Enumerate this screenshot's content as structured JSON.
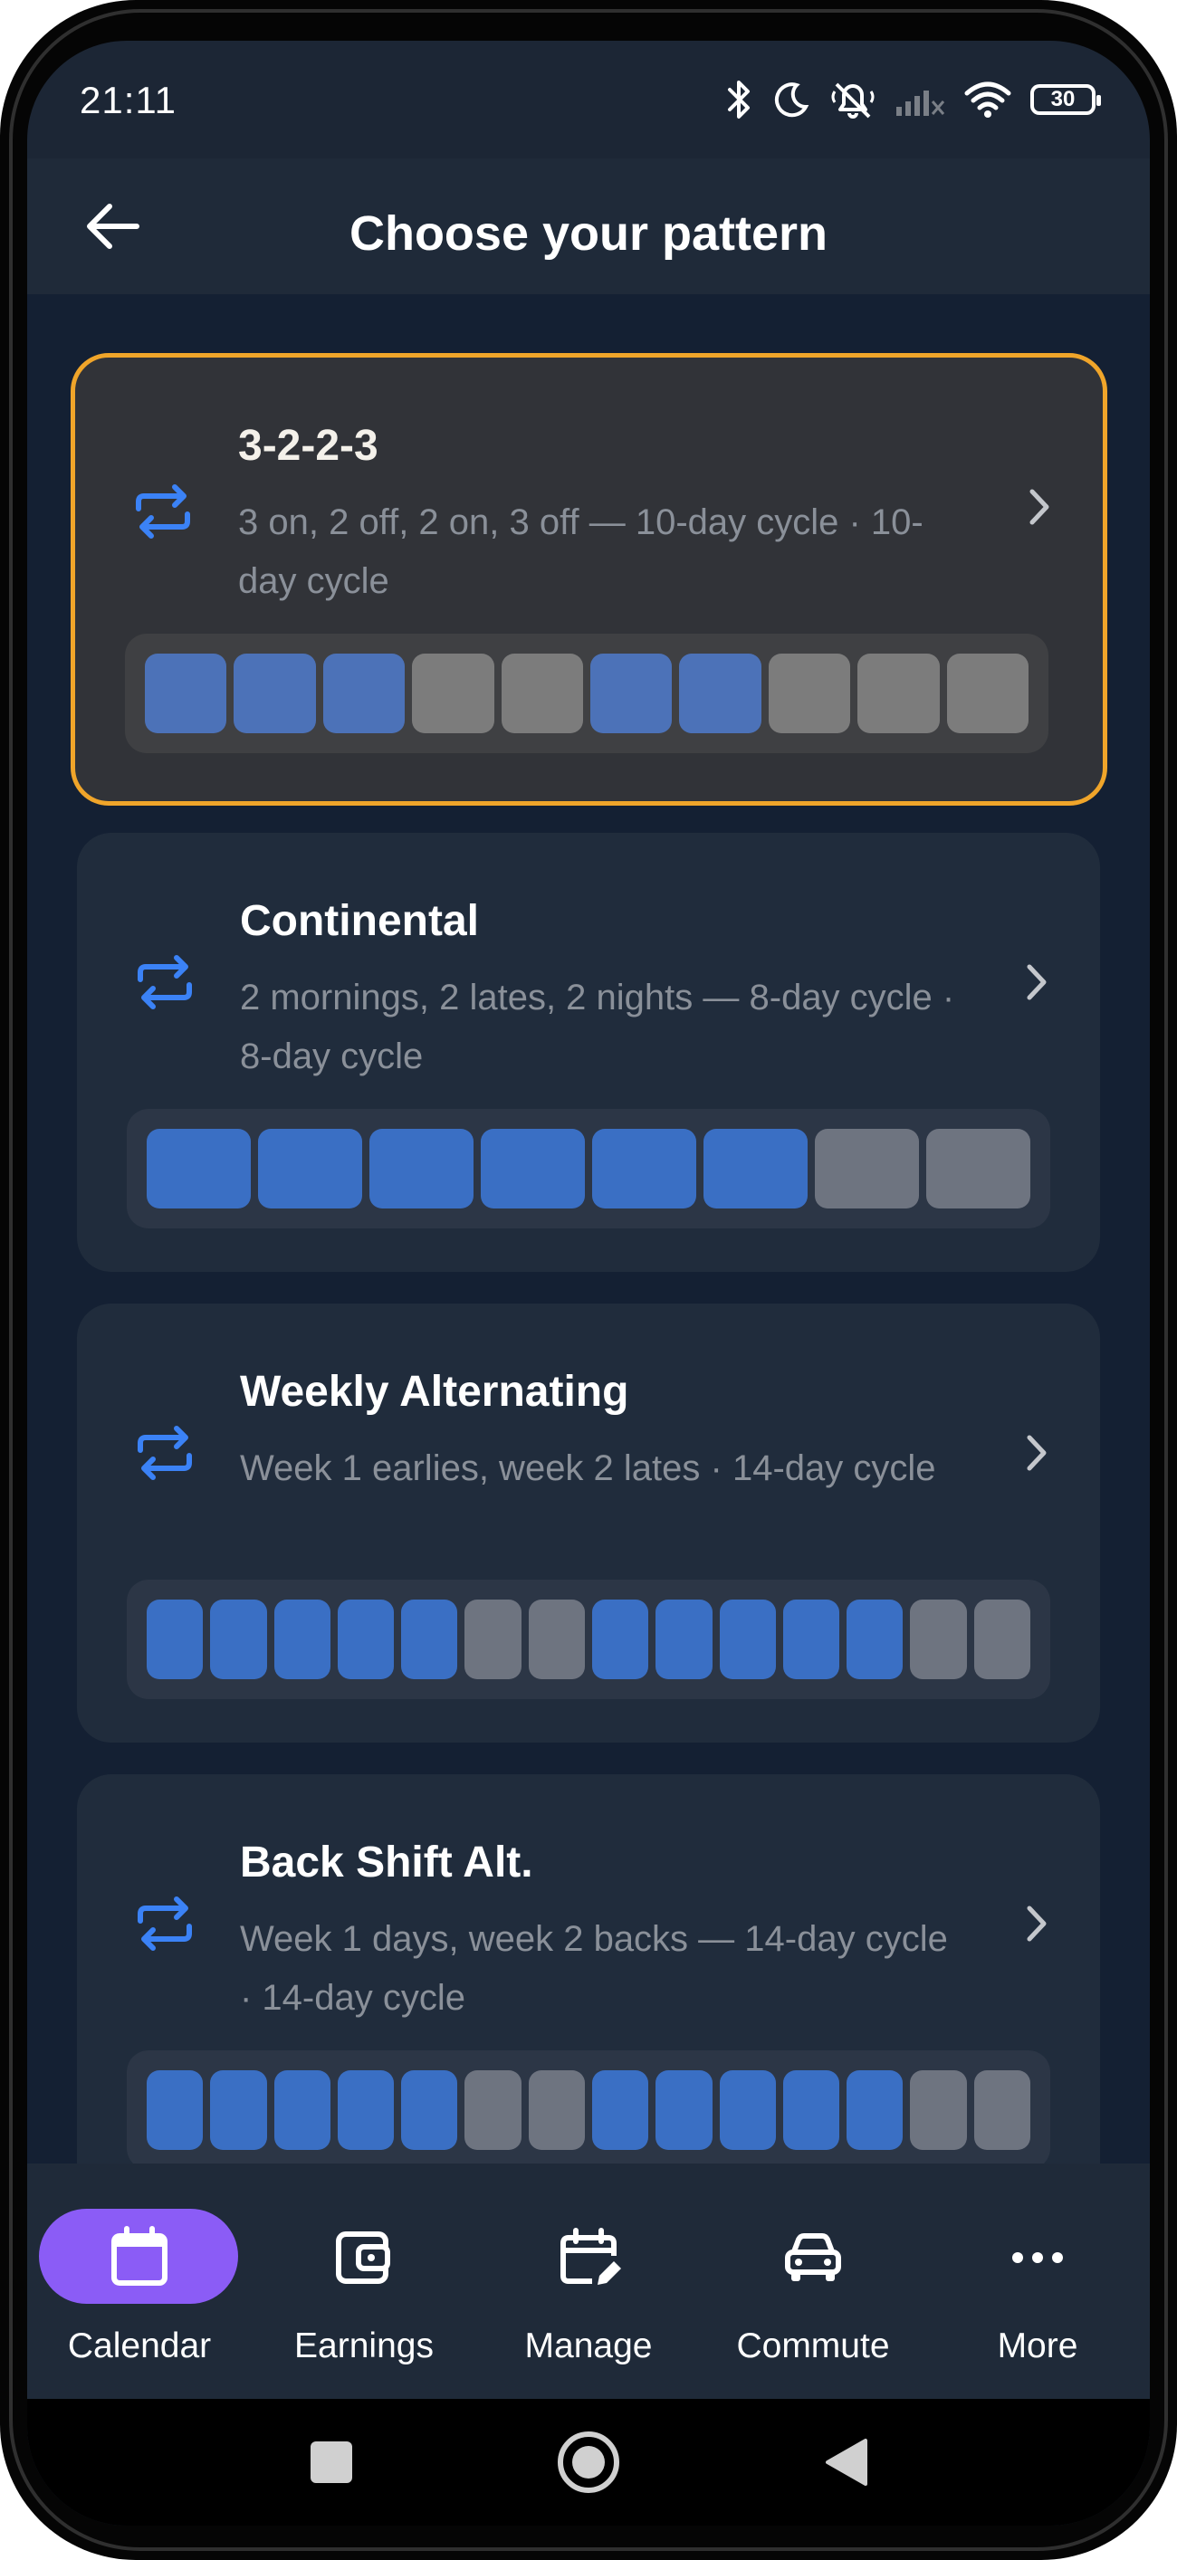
{
  "status_bar": {
    "time": "21:11",
    "battery": "30"
  },
  "header": {
    "title": "Choose your pattern"
  },
  "colors": {
    "on_selected": "#4c72b8",
    "off_selected": "#7c7c7c",
    "on": "#3a6fc4",
    "off": "#6e7480",
    "accent_border": "#f0a52a",
    "nav_active": "#8b5cf6",
    "icon_blue": "#3b82f6"
  },
  "patterns": [
    {
      "title": "3-2-2-3",
      "subtitle": "3 on, 2 off, 2 on, 3 off — 10-day cycle · 10-day cycle",
      "selected": true,
      "days": [
        1,
        1,
        1,
        0,
        0,
        1,
        1,
        0,
        0,
        0
      ]
    },
    {
      "title": "Continental",
      "subtitle": "2 mornings, 2 lates, 2 nights — 8-day cycle · 8-day cycle",
      "selected": false,
      "days": [
        1,
        1,
        1,
        1,
        1,
        1,
        0,
        0
      ]
    },
    {
      "title": "Weekly Alternating",
      "subtitle": "Week 1 earlies, week 2 lates · 14-day cycle",
      "selected": false,
      "days": [
        1,
        1,
        1,
        1,
        1,
        0,
        0,
        1,
        1,
        1,
        1,
        1,
        0,
        0
      ]
    },
    {
      "title": "Back Shift Alt.",
      "subtitle": "Week 1 days, week 2 backs — 14-day cycle · 14-day cycle",
      "selected": false,
      "days": [
        1,
        1,
        1,
        1,
        1,
        0,
        0,
        1,
        1,
        1,
        1,
        1,
        0,
        0
      ]
    }
  ],
  "nav": {
    "items": [
      {
        "label": "Calendar",
        "icon": "calendar-icon",
        "active": true
      },
      {
        "label": "Earnings",
        "icon": "wallet-icon",
        "active": false
      },
      {
        "label": "Manage",
        "icon": "calendar-edit-icon",
        "active": false
      },
      {
        "label": "Commute",
        "icon": "car-icon",
        "active": false
      },
      {
        "label": "More",
        "icon": "more-icon",
        "active": false
      }
    ]
  }
}
